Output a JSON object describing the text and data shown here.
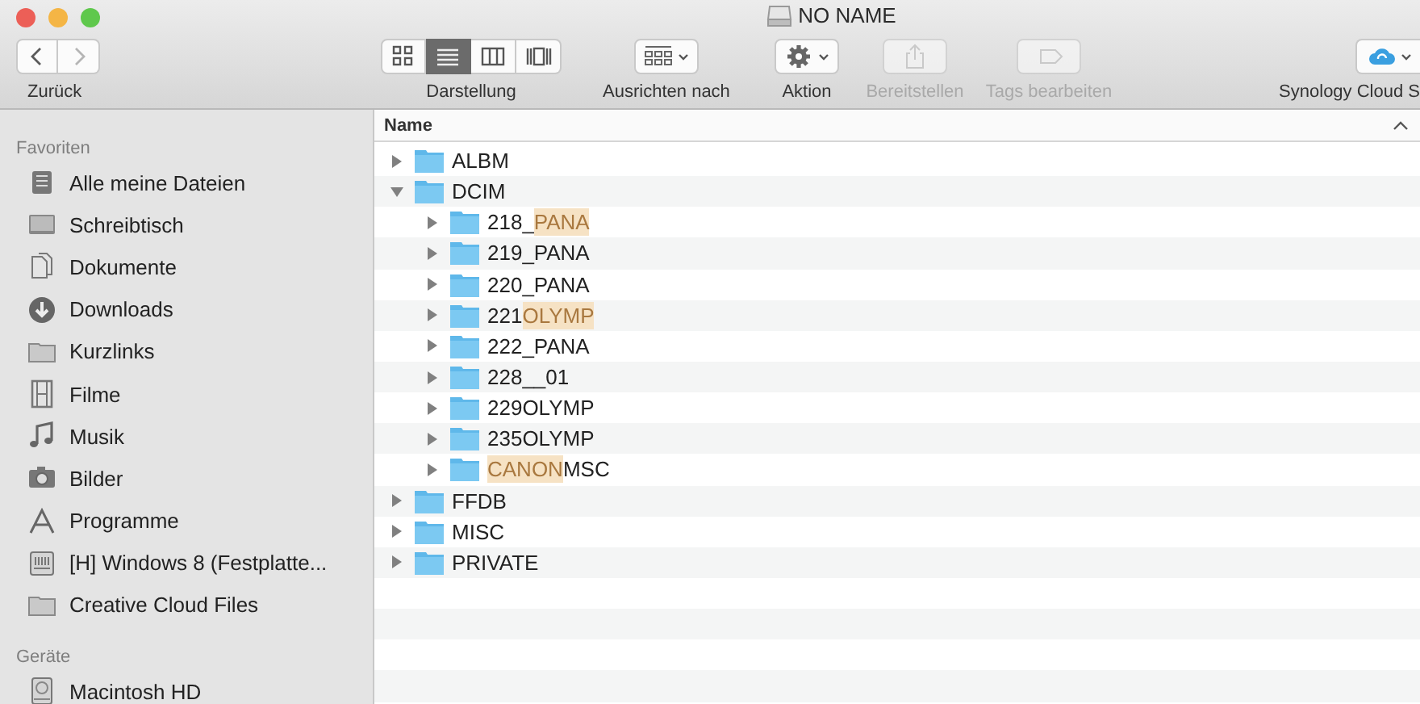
{
  "window": {
    "title": "NO NAME"
  },
  "toolbar": {
    "nav_label": "Zurück",
    "nav_buttons": [
      {
        "kind": "back",
        "disabled": false
      },
      {
        "kind": "forward",
        "disabled": true
      }
    ],
    "view": {
      "label": "Darstellung",
      "modes": [
        {
          "kind": "icons",
          "selected": false
        },
        {
          "kind": "list",
          "selected": true
        },
        {
          "kind": "columns",
          "selected": false
        },
        {
          "kind": "coverflow",
          "selected": false
        }
      ]
    },
    "actions": [
      {
        "kind": "arrange",
        "label": "Ausrichten nach",
        "menu": true,
        "disabled": false
      },
      {
        "kind": "action",
        "label": "Aktion",
        "menu": true,
        "disabled": false
      },
      {
        "kind": "share",
        "label": "Bereitstellen",
        "menu": false,
        "disabled": true
      },
      {
        "kind": "tags",
        "label": "Tags bearbeiten",
        "menu": false,
        "disabled": true
      },
      {
        "kind": "cloud",
        "label": "Synology Cloud S",
        "menu": true,
        "disabled": false
      }
    ]
  },
  "sidebar": {
    "sections": [
      {
        "title": "Favoriten",
        "items": [
          {
            "label": "Alle meine Dateien"
          },
          {
            "label": "Schreibtisch"
          },
          {
            "label": "Dokumente"
          },
          {
            "label": "Downloads"
          },
          {
            "label": "Kurzlinks"
          },
          {
            "label": "Filme"
          },
          {
            "label": "Musik"
          },
          {
            "label": "Bilder"
          },
          {
            "label": "Programme"
          },
          {
            "label": "[H] Windows 8 (Festplatte..."
          },
          {
            "label": "Creative Cloud Files"
          }
        ]
      },
      {
        "title": "Geräte",
        "items": [
          {
            "label": "Macintosh HD"
          }
        ]
      }
    ]
  },
  "list": {
    "column": "Name",
    "rows": [
      {
        "name": [
          {
            "text": "ALBM",
            "highlighted": false
          }
        ],
        "expanded": false
      },
      {
        "name": [
          {
            "text": "DCIM",
            "highlighted": false
          }
        ],
        "expanded": true,
        "children": [
          {
            "name": [
              {
                "text": "218_",
                "highlighted": false
              },
              {
                "text": "PANA",
                "highlighted": true
              }
            ],
            "expanded": false
          },
          {
            "name": [
              {
                "text": "219_PANA",
                "highlighted": false
              }
            ],
            "expanded": false
          },
          {
            "name": [
              {
                "text": "220_PANA",
                "highlighted": false
              }
            ],
            "expanded": false
          },
          {
            "name": [
              {
                "text": "221",
                "highlighted": false
              },
              {
                "text": "OLYMP",
                "highlighted": true
              }
            ],
            "expanded": false
          },
          {
            "name": [
              {
                "text": "222_PANA",
                "highlighted": false
              }
            ],
            "expanded": false
          },
          {
            "name": [
              {
                "text": "228__01",
                "highlighted": false
              }
            ],
            "expanded": false
          },
          {
            "name": [
              {
                "text": "229OLYMP",
                "highlighted": false
              }
            ],
            "expanded": false
          },
          {
            "name": [
              {
                "text": "235OLYMP",
                "highlighted": false
              }
            ],
            "expanded": false
          },
          {
            "name": [
              {
                "text": "CANON",
                "highlighted": true
              },
              {
                "text": "MSC",
                "highlighted": false
              }
            ],
            "expanded": false
          }
        ]
      },
      {
        "name": [
          {
            "text": "FFDB",
            "highlighted": false
          }
        ],
        "expanded": false
      },
      {
        "name": [
          {
            "text": "MISC",
            "highlighted": false
          }
        ],
        "expanded": false
      },
      {
        "name": [
          {
            "text": "PRIVATE",
            "highlighted": false
          }
        ],
        "expanded": false
      }
    ]
  }
}
